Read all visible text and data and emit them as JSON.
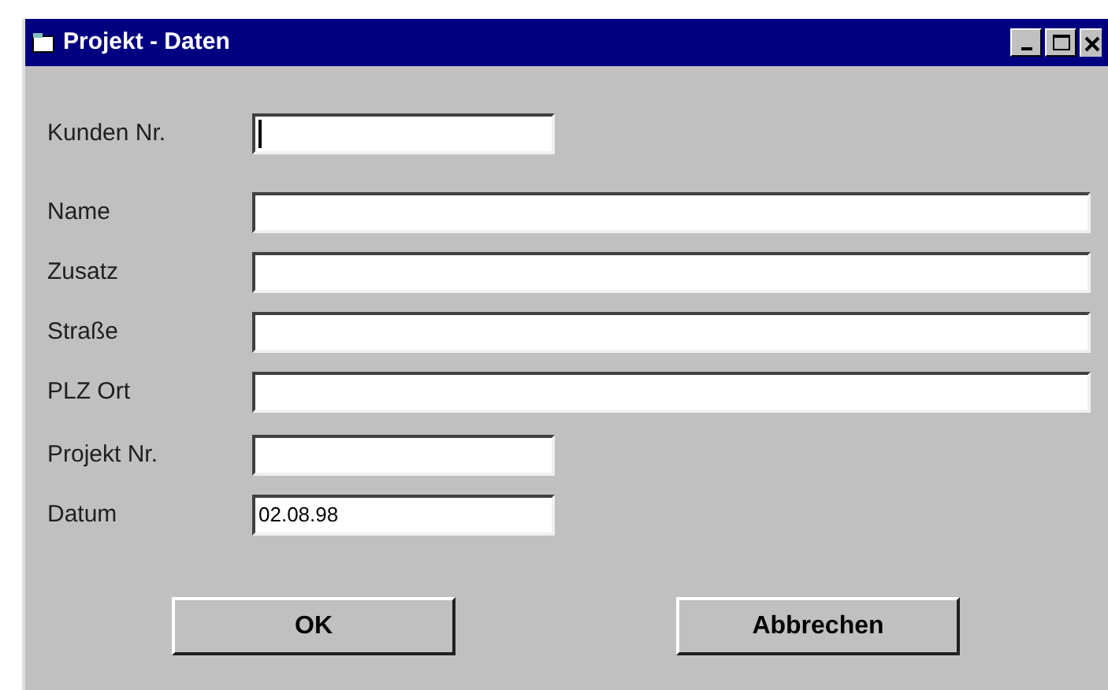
{
  "window": {
    "title": "Projekt - Daten"
  },
  "fields": [
    {
      "label": "Kunden Nr.",
      "kind": "short",
      "focused": true
    },
    {
      "label": "Name",
      "kind": "wide",
      "focused": false
    },
    {
      "label": "Zusatz",
      "kind": "wide",
      "focused": false
    },
    {
      "label": "Straße",
      "kind": "wide",
      "focused": false
    },
    {
      "label": "PLZ Ort",
      "kind": "wide",
      "focused": false
    },
    {
      "label": "Projekt Nr.",
      "kind": "short",
      "focused": false
    },
    {
      "label": "Datum",
      "kind": "short",
      "focused": false,
      "value": "02.08.98"
    }
  ],
  "buttons": [
    "OK",
    "Abbrechen"
  ]
}
